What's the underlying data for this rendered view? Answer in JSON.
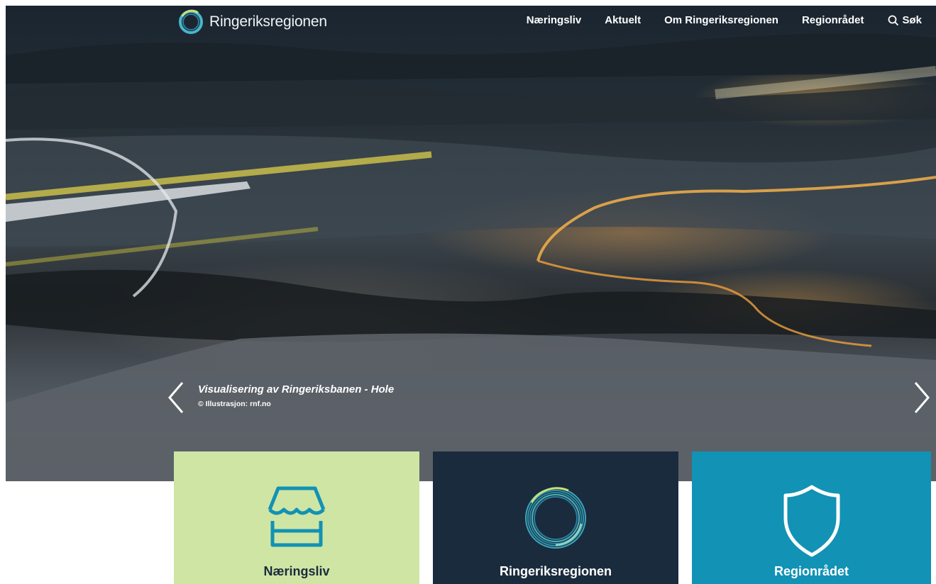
{
  "header": {
    "logo_text": "Ringeriksregionen",
    "nav": [
      {
        "label": "Næringsliv"
      },
      {
        "label": "Aktuelt"
      },
      {
        "label": "Om Ringeriksregionen"
      },
      {
        "label": "Regionrådet"
      }
    ],
    "search_label": "Søk"
  },
  "hero": {
    "caption_title": "Visualisering av Ringeriksbanen - Hole",
    "caption_credit": "© Illustrasjon: rnf.no"
  },
  "cards": [
    {
      "label": "Næringsliv",
      "icon": "storefront-icon",
      "bg": "#cfe5a4"
    },
    {
      "label": "Ringeriksregionen",
      "icon": "ring-logo-icon",
      "bg": "#1a2b3d"
    },
    {
      "label": "Regionrådet",
      "icon": "shield-icon",
      "bg": "#1292b4"
    }
  ],
  "colors": {
    "accent_teal": "#1292b4",
    "navy": "#1a2b3d",
    "light_green": "#cfe5a4"
  }
}
